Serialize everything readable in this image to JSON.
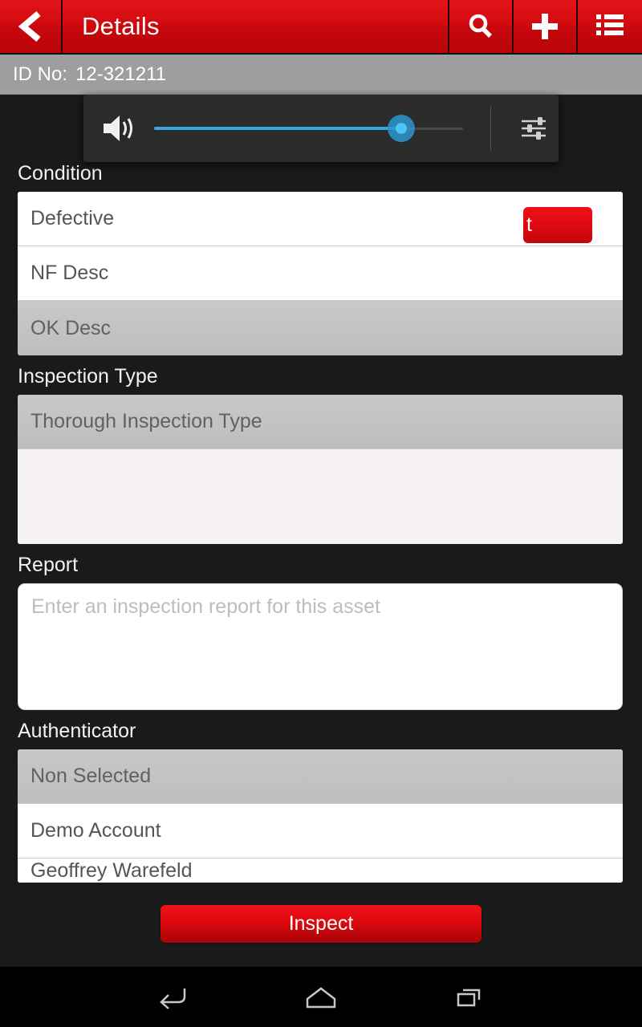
{
  "appbar": {
    "back_icon": "chevron-left-icon",
    "title": "Details",
    "search_icon": "search-icon",
    "add_icon": "plus-icon",
    "list_icon": "list-menu-icon"
  },
  "id_bar": {
    "label": "ID No:",
    "value": "12-321211"
  },
  "volume_overlay": {
    "speaker_icon": "volume-speaker-icon",
    "settings_icon": "equalizer-tune-icon",
    "level_percent": 80
  },
  "hidden_button": {
    "visible_text": "t"
  },
  "condition": {
    "label": "Condition",
    "options": [
      {
        "label": "Defective",
        "selected": false
      },
      {
        "label": "NF Desc",
        "selected": false
      },
      {
        "label": "OK Desc",
        "selected": true
      }
    ]
  },
  "inspection_type": {
    "label": "Inspection Type",
    "options": [
      {
        "label": "Thorough Inspection Type",
        "selected": true
      }
    ]
  },
  "report": {
    "label": "Report",
    "value": "",
    "placeholder": "Enter an inspection report for this asset"
  },
  "authenticator": {
    "label": "Authenticator",
    "options": [
      {
        "label": "Non Selected",
        "selected": true
      },
      {
        "label": "Demo Account",
        "selected": false
      },
      {
        "label": "Geoffrey Warefeld",
        "selected": false
      }
    ]
  },
  "actions": {
    "inspect_label": "Inspect"
  },
  "navbar": {
    "back_icon": "android-back-icon",
    "home_icon": "android-home-icon",
    "recents_icon": "android-recents-icon"
  },
  "colors": {
    "brand_red": "#d1090e",
    "id_bar_gray": "#9e9e9e",
    "content_bg": "#1a1a1a",
    "slider_blue": "#3aa5dd",
    "selected_row": "#c2c2c2"
  }
}
